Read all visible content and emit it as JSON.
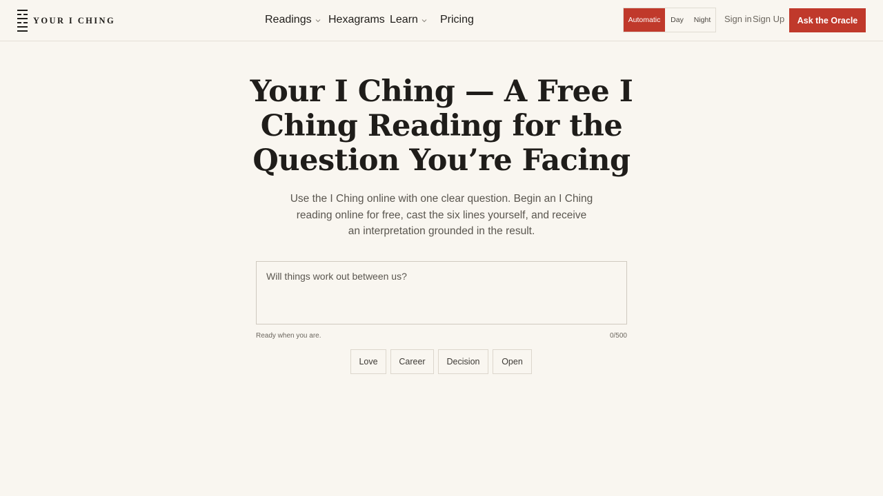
{
  "brand": {
    "name": "YOUR I CHING",
    "logo_icon": "hexagram-icon"
  },
  "nav": {
    "items": [
      {
        "label": "Readings",
        "has_dropdown": true
      },
      {
        "label": "Hexagrams",
        "has_dropdown": false
      },
      {
        "label": "Learn",
        "has_dropdown": true
      },
      {
        "label": "Pricing",
        "has_dropdown": false
      }
    ]
  },
  "theme_toggle": {
    "options": [
      "Automatic",
      "Day",
      "Night"
    ],
    "selected": "Automatic"
  },
  "auth": {
    "sign_in": "Sign in",
    "sign_up": "Sign Up"
  },
  "cta": {
    "label": "Ask the Oracle"
  },
  "hero": {
    "title": "Your I Ching — A Free I Ching Reading for the Question You’re Facing",
    "subtitle": "Use the I Ching online with one clear question. Begin an I Ching reading online for free, cast the six lines yourself, and receive an interpretation grounded in the result."
  },
  "question": {
    "placeholder": "Will things work out between us?",
    "value": "",
    "status": "Ready when you are.",
    "counter": "0/500"
  },
  "topics": [
    "Love",
    "Career",
    "Decision",
    "Open"
  ],
  "colors": {
    "accent": "#c0392b",
    "background": "#f9f6f0",
    "text": "#1f1d1a",
    "border": "#e4dfd6"
  }
}
